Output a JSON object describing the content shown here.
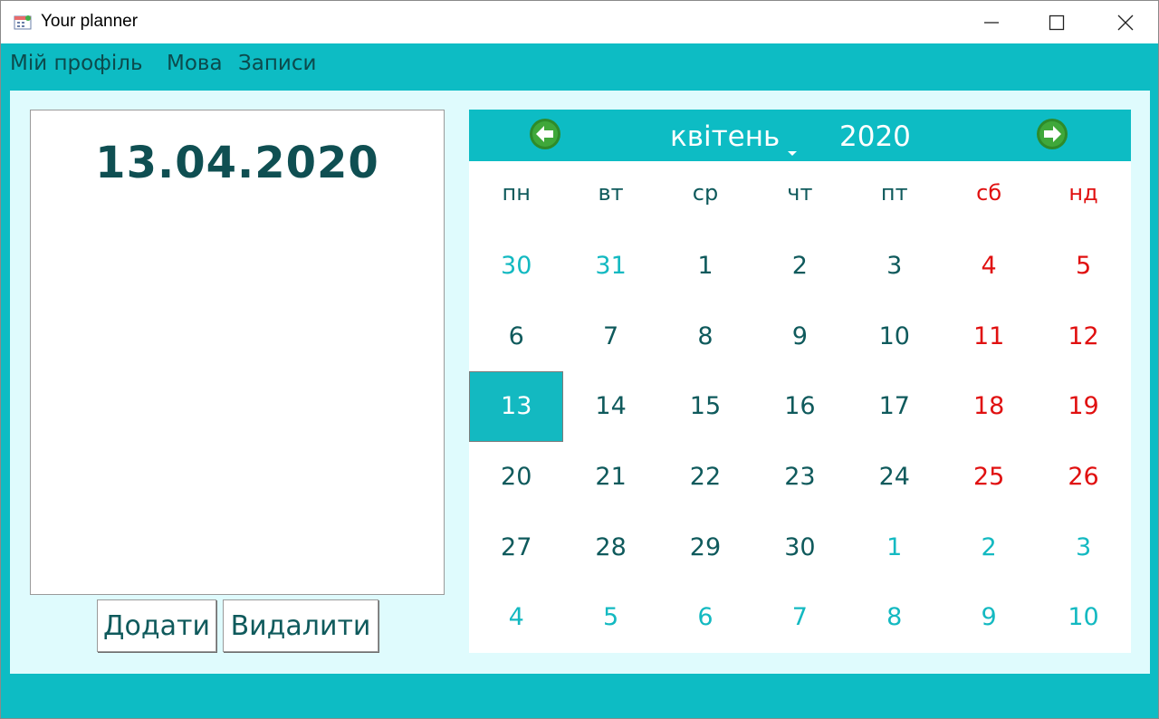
{
  "window": {
    "title": "Your planner",
    "controls": [
      "minimize",
      "maximize",
      "close"
    ]
  },
  "menu": [
    {
      "label": "Мій профіль"
    },
    {
      "label": "Мова"
    },
    {
      "label": "Записи"
    }
  ],
  "notes": {
    "selected_date": "13.04.2020",
    "add_label": "Додати",
    "delete_label": "Видалити"
  },
  "calendar": {
    "month": "квітень",
    "year": "2020",
    "weekdays": [
      "пн",
      "вт",
      "ср",
      "чт",
      "пт",
      "сб",
      "нд"
    ],
    "weeks": [
      [
        {
          "d": "30",
          "o": true
        },
        {
          "d": "31",
          "o": true
        },
        {
          "d": "1"
        },
        {
          "d": "2"
        },
        {
          "d": "3"
        },
        {
          "d": "4",
          "w": true
        },
        {
          "d": "5",
          "w": true
        }
      ],
      [
        {
          "d": "6"
        },
        {
          "d": "7"
        },
        {
          "d": "8"
        },
        {
          "d": "9"
        },
        {
          "d": "10"
        },
        {
          "d": "11",
          "w": true
        },
        {
          "d": "12",
          "w": true
        }
      ],
      [
        {
          "d": "13",
          "s": true
        },
        {
          "d": "14"
        },
        {
          "d": "15"
        },
        {
          "d": "16"
        },
        {
          "d": "17"
        },
        {
          "d": "18",
          "w": true
        },
        {
          "d": "19",
          "w": true
        }
      ],
      [
        {
          "d": "20"
        },
        {
          "d": "21"
        },
        {
          "d": "22"
        },
        {
          "d": "23"
        },
        {
          "d": "24"
        },
        {
          "d": "25",
          "w": true
        },
        {
          "d": "26",
          "w": true
        }
      ],
      [
        {
          "d": "27"
        },
        {
          "d": "28"
        },
        {
          "d": "29"
        },
        {
          "d": "30"
        },
        {
          "d": "1",
          "o": true
        },
        {
          "d": "2",
          "o": true
        },
        {
          "d": "3",
          "o": true
        }
      ],
      [
        {
          "d": "4",
          "o": true
        },
        {
          "d": "5",
          "o": true
        },
        {
          "d": "6",
          "o": true
        },
        {
          "d": "7",
          "o": true
        },
        {
          "d": "8",
          "o": true
        },
        {
          "d": "9",
          "o": true
        },
        {
          "d": "10",
          "o": true
        }
      ]
    ]
  },
  "colors": {
    "accent": "#0dbcc4",
    "panel_bg": "#dffbfd",
    "text_dark": "#0f5a5c",
    "weekend": "#e01010",
    "nav_button": "#2e8b2a"
  },
  "icons": {
    "app": "calendar-icon",
    "prev": "arrow-left-icon",
    "next": "arrow-right-icon"
  }
}
